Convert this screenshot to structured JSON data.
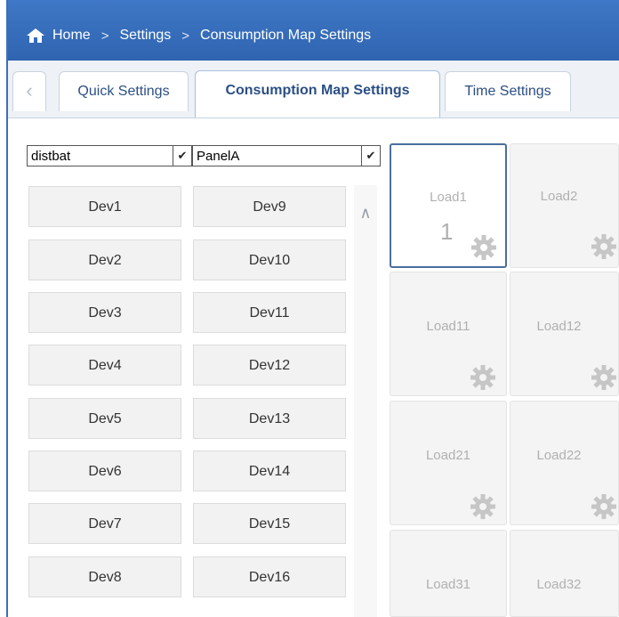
{
  "breadcrumb": {
    "items": [
      "Home",
      "Settings",
      "Consumption Map Settings"
    ],
    "separator": ">"
  },
  "tabs": [
    {
      "label": "Quick Settings",
      "active": false
    },
    {
      "label": "Consumption Map Settings",
      "active": true
    },
    {
      "label": "Time Settings",
      "active": false
    }
  ],
  "filters": {
    "device_group": {
      "value": "distbat"
    },
    "panel": {
      "value": "PanelA"
    }
  },
  "devices": {
    "left": [
      "Dev1",
      "Dev2",
      "Dev3",
      "Dev4",
      "Dev5",
      "Dev6",
      "Dev7",
      "Dev8"
    ],
    "right": [
      "Dev9",
      "Dev10",
      "Dev11",
      "Dev12",
      "Dev13",
      "Dev14",
      "Dev15",
      "Dev16"
    ]
  },
  "loads": [
    {
      "name": "Load1",
      "assigned": "1",
      "selected": true
    },
    {
      "name": "Load2",
      "assigned": "",
      "selected": false
    },
    {
      "name": "Load11",
      "assigned": "",
      "selected": false
    },
    {
      "name": "Load12",
      "assigned": "",
      "selected": false
    },
    {
      "name": "Load21",
      "assigned": "",
      "selected": false
    },
    {
      "name": "Load22",
      "assigned": "",
      "selected": false
    },
    {
      "name": "Load31",
      "assigned": "",
      "selected": false
    },
    {
      "name": "Load32",
      "assigned": "",
      "selected": false
    }
  ],
  "icons": {
    "home": "home-icon",
    "tab_prev": "chevron-left-icon",
    "scroll_up": "chevron-up-icon",
    "load_settings": "gear-icon"
  },
  "colors": {
    "header_bg": "#3a70bf",
    "tab_text": "#2b4f85",
    "load_selected_border": "#4a6e9e"
  }
}
